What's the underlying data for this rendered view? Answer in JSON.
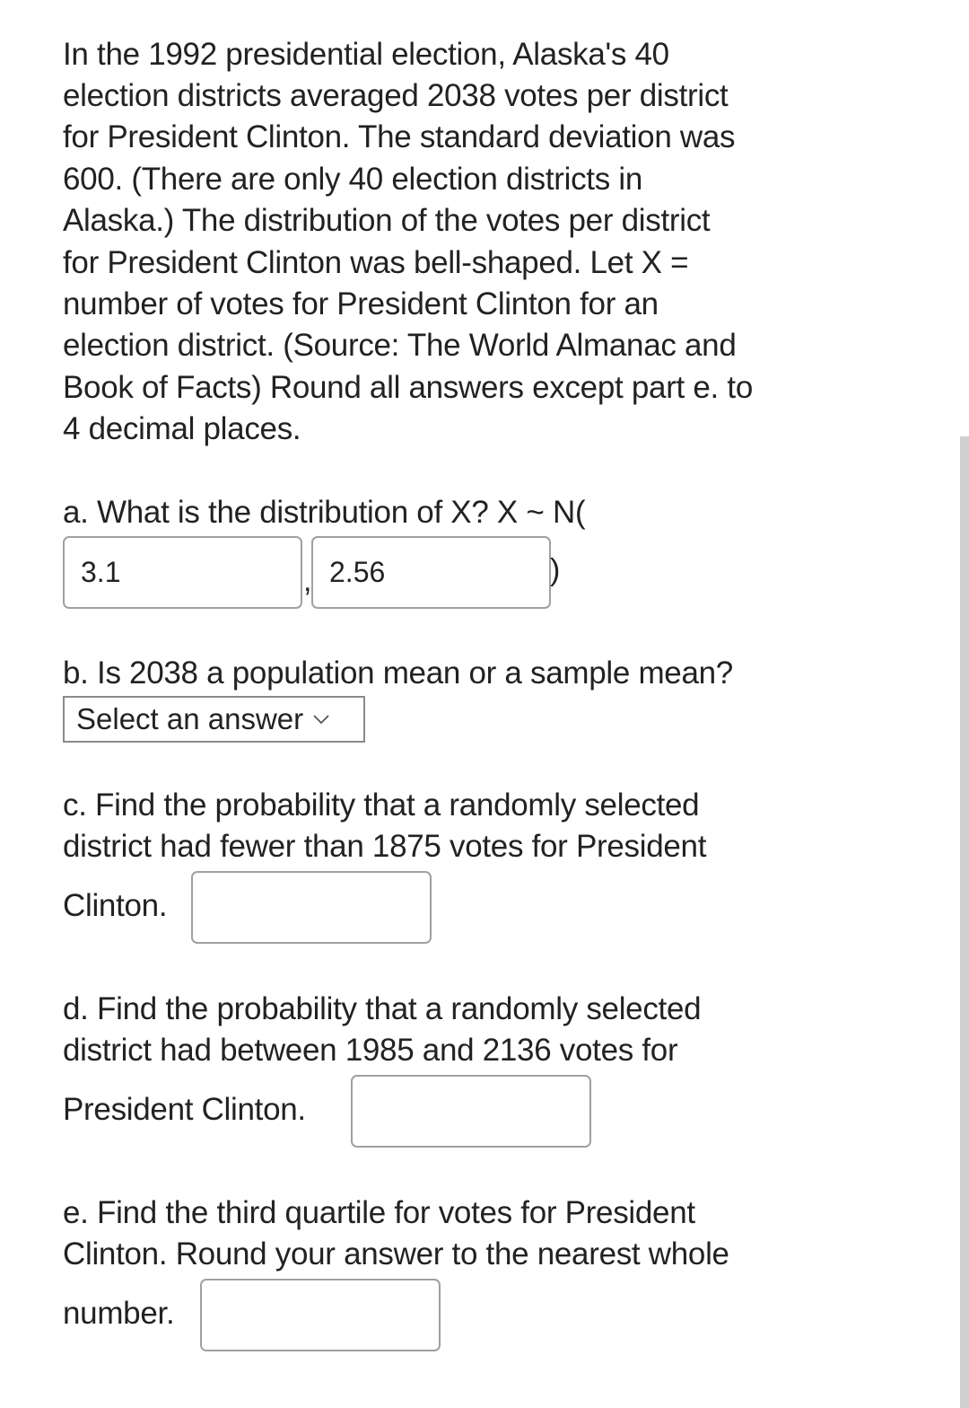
{
  "intro": {
    "lines": [
      "In the 1992 presidential election, Alaska's 40",
      "election districts averaged 2038 votes per district",
      "for President Clinton. The standard deviation was",
      "600. (There are only 40 election districts in",
      "Alaska.) The distribution of the votes per district",
      "for President Clinton was bell-shaped. Let X =",
      "number of votes for President Clinton for an",
      "election district. (Source: The World Almanac and",
      "Book of Facts) Round all answers except part e. to",
      "4 decimal places."
    ]
  },
  "part_a": {
    "question": "a. What is the distribution of X? X ~ N(",
    "mean_value": "3.1",
    "sd_value": "2.56",
    "separator": ",",
    "close": ")"
  },
  "part_b": {
    "question": "b. Is 2038 a population mean or a sample mean?",
    "select_value": "Select an answer"
  },
  "part_c": {
    "lines": [
      "c. Find the probability that a randomly selected",
      "district had fewer than 1875 votes for President",
      "Clinton."
    ],
    "answer_value": ""
  },
  "part_d": {
    "lines": [
      "d. Find the probability that a randomly selected",
      "district had between 1985 and 2136 votes for",
      "President Clinton."
    ],
    "answer_value": ""
  },
  "part_e": {
    "lines": [
      "e. Find the third quartile for votes for President",
      "Clinton. Round your answer to the nearest whole",
      "number."
    ],
    "answer_value": ""
  }
}
